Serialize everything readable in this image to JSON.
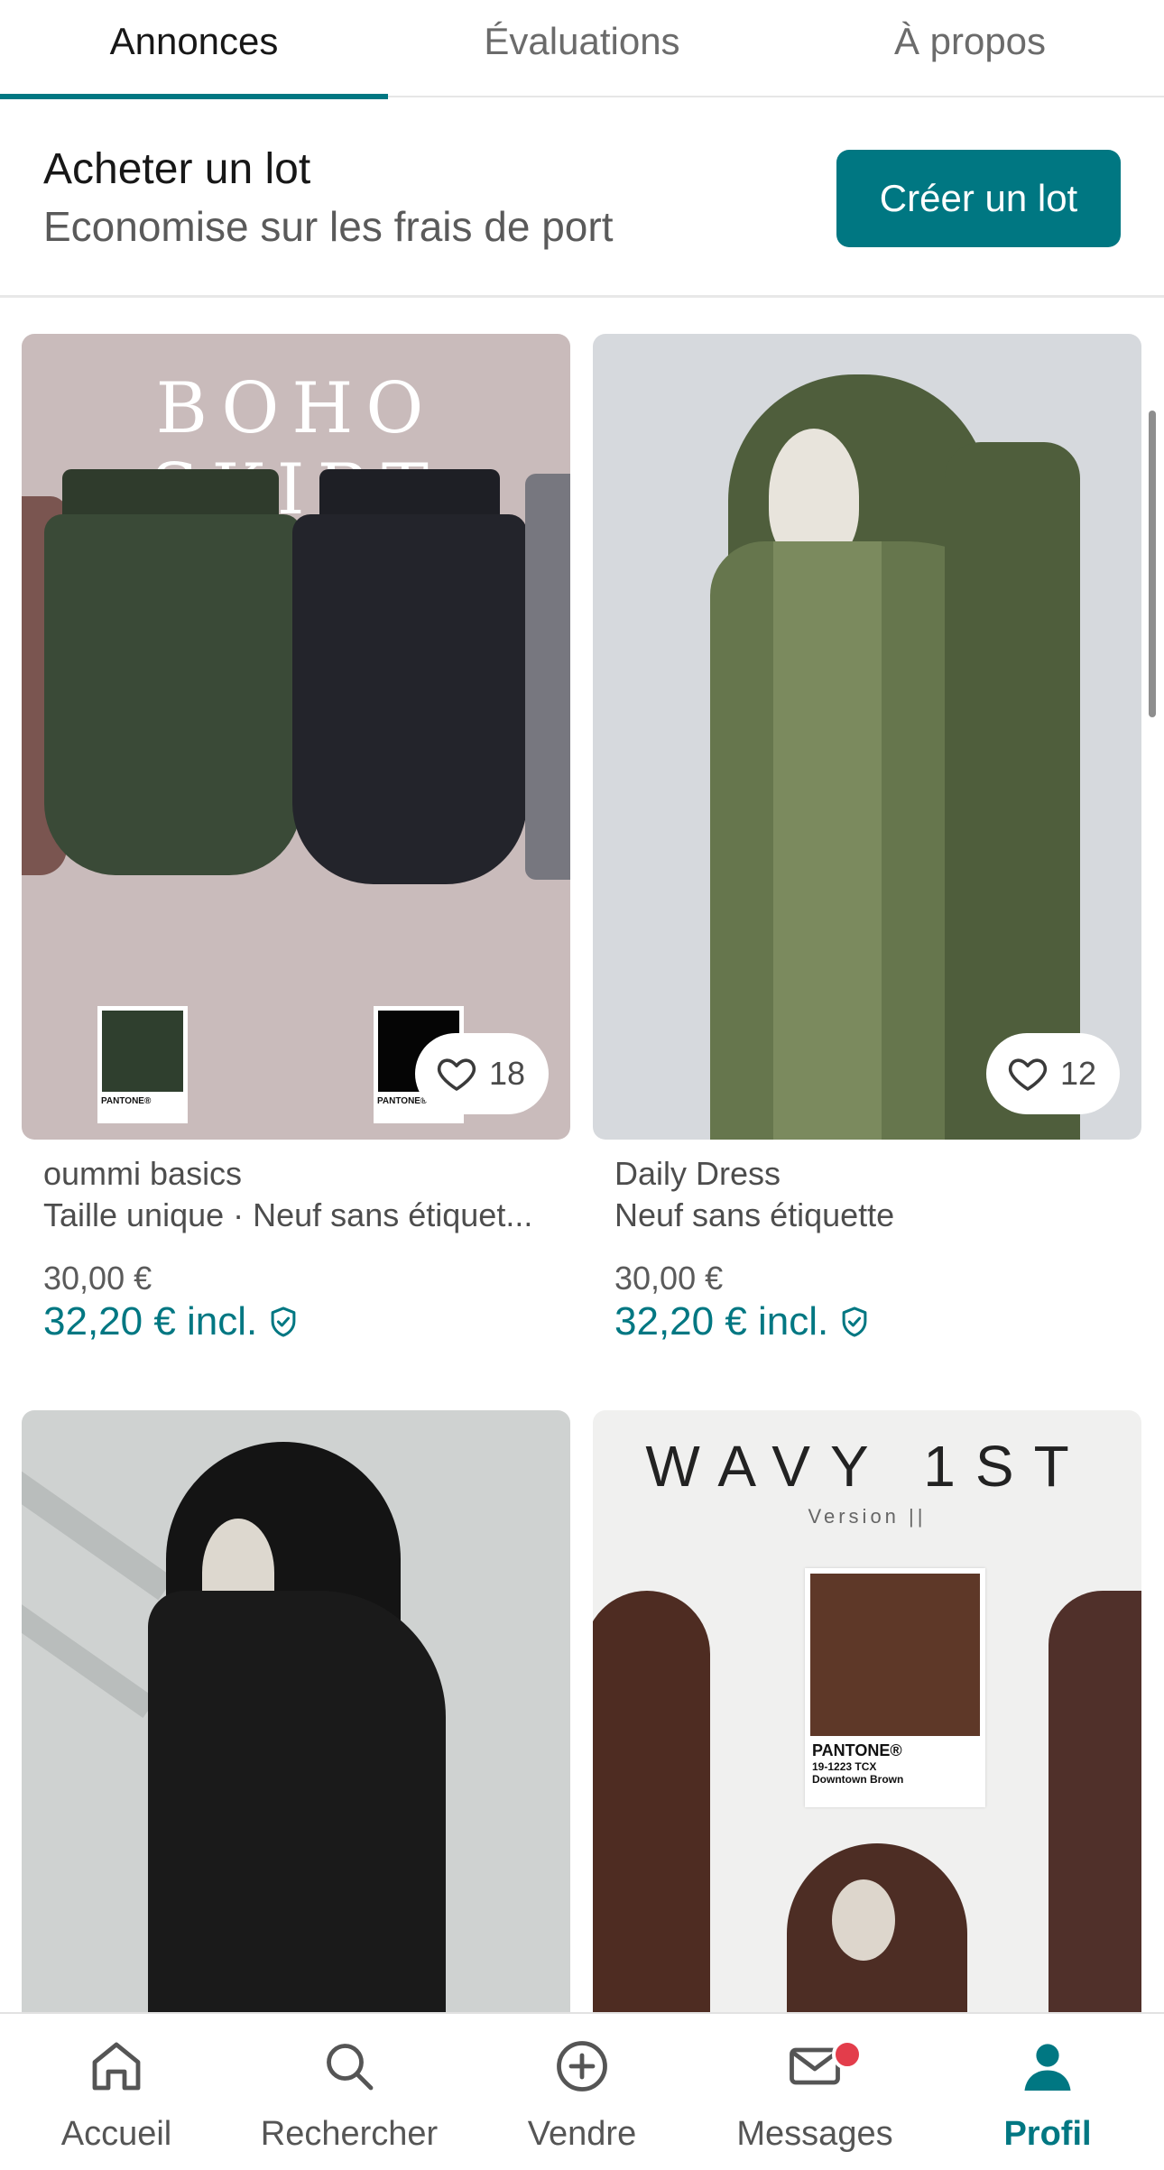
{
  "tabs": [
    {
      "label": "Annonces",
      "active": true
    },
    {
      "label": "Évaluations",
      "active": false
    },
    {
      "label": "À propos",
      "active": false
    }
  ],
  "bundle": {
    "title": "Acheter un lot",
    "subtitle": "Economise sur les frais de port",
    "button": "Créer un lot"
  },
  "items": [
    {
      "image_text": "BOHO SKIRT",
      "swatch_left_label": "PANTONE®",
      "swatch_right_label": "PANTONE®",
      "favorites": "18",
      "brand": "oummi basics",
      "details": "Taille unique · Neuf sans étiquet...",
      "price": "30,00 €",
      "price_incl": "32,20 € incl."
    },
    {
      "favorites": "12",
      "brand": "Daily Dress",
      "details": "Neuf sans étiquette",
      "price": "30,00 €",
      "price_incl": "32,20 € incl."
    },
    {},
    {
      "image_title": "WAVY 1ST",
      "image_subtitle": "Version ||",
      "swatch_brand": "PANTONE®",
      "swatch_code": "19-1223 TCX",
      "swatch_name": "Downtown Brown"
    }
  ],
  "nav": [
    {
      "label": "Accueil",
      "icon": "home-icon",
      "active": false
    },
    {
      "label": "Rechercher",
      "icon": "search-icon",
      "active": false
    },
    {
      "label": "Vendre",
      "icon": "plus-circle-icon",
      "active": false
    },
    {
      "label": "Messages",
      "icon": "mail-icon",
      "active": false,
      "badge": true
    },
    {
      "label": "Profil",
      "icon": "person-icon",
      "active": true
    }
  ],
  "colors": {
    "accent": "#007782",
    "badge": "#e33d4b"
  }
}
